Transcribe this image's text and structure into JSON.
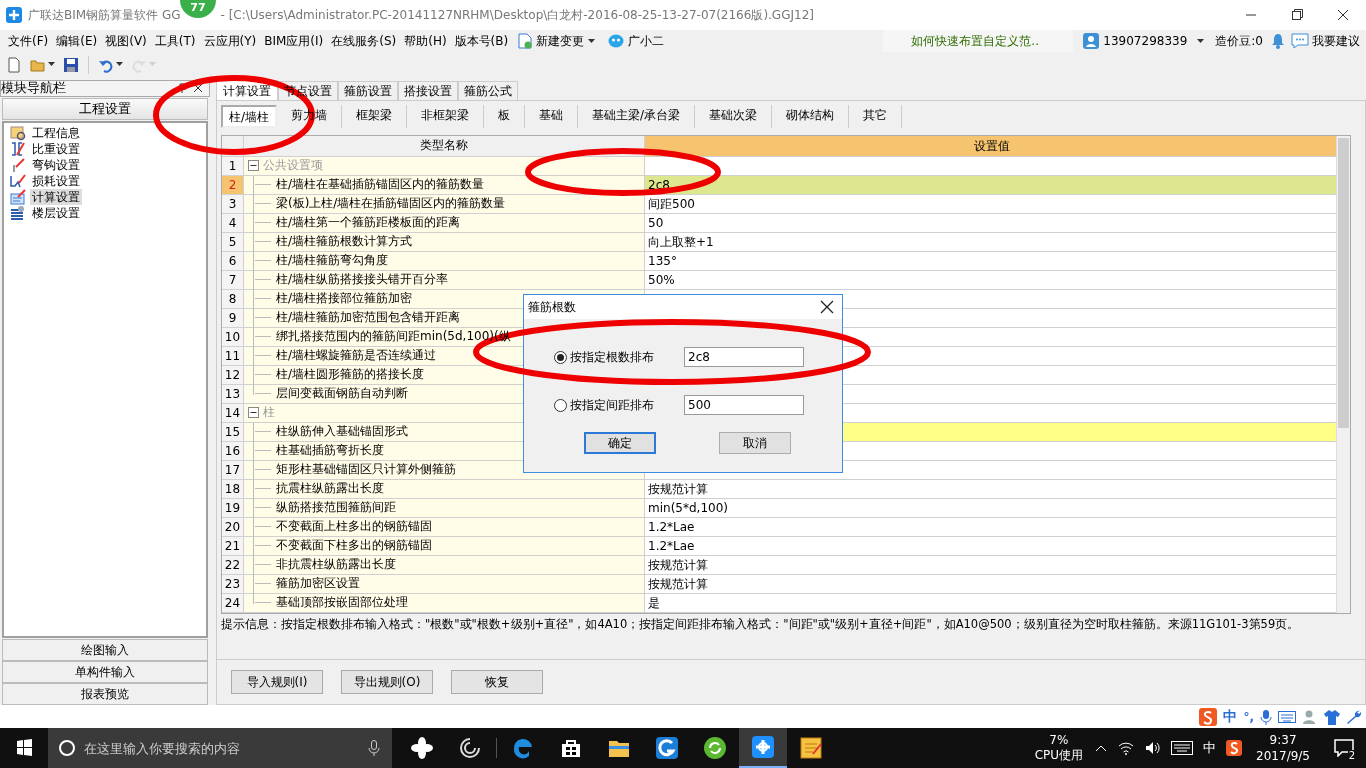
{
  "window": {
    "title_start": "广联达BIM钢筋算量软件 GG",
    "title_rest": "- [C:\\Users\\Administrator.PC-20141127NRHM\\Desktop\\白龙村-2016-08-25-13-27-07(2166版).GGJ12]",
    "badge": "77"
  },
  "menu": [
    "文件(F)",
    "编辑(E)",
    "视图(V)",
    "工具(T)",
    "云应用(Y)",
    "BIM应用(I)",
    "在线服务(S)",
    "帮助(H)",
    "版本号(B)"
  ],
  "menu_extras": [
    {
      "kind": "change",
      "label": "新建变更"
    },
    {
      "kind": "assistant",
      "label": "广小二"
    }
  ],
  "tip_link": "如何快速布置自定义范..",
  "account": {
    "user": "13907298339",
    "beans": "造价豆:0",
    "suggest": "我要建议"
  },
  "toolbar": [
    {
      "kind": "new",
      "disabled": false
    },
    {
      "kind": "open",
      "disabled": false
    },
    {
      "kind": "save",
      "disabled": false
    },
    {
      "kind": "undo",
      "disabled": false
    },
    {
      "kind": "redo",
      "disabled": true
    }
  ],
  "nav": {
    "title": "模块导航栏",
    "section": "工程设置",
    "items": [
      {
        "kind": "info",
        "label": "工程信息",
        "selected": false
      },
      {
        "kind": "weight",
        "label": "比重设置",
        "selected": false
      },
      {
        "kind": "hook",
        "label": "弯钩设置",
        "selected": false
      },
      {
        "kind": "loss",
        "label": "损耗设置",
        "selected": false
      },
      {
        "kind": "calc",
        "label": "计算设置",
        "selected": true
      },
      {
        "kind": "floor",
        "label": "楼层设置",
        "selected": false
      }
    ],
    "bottom": [
      "绘图输入",
      "单构件输入",
      "报表预览"
    ]
  },
  "tabs": [
    {
      "label": "计算设置",
      "selected": true
    },
    {
      "label": "节点设置",
      "selected": false
    },
    {
      "label": "箍筋设置",
      "selected": false
    },
    {
      "label": "搭接设置",
      "selected": false
    },
    {
      "label": "箍筋公式",
      "selected": false
    }
  ],
  "subtabs": [
    {
      "label": "柱/墙柱",
      "selected": true
    },
    {
      "label": "剪力墙",
      "selected": false
    },
    {
      "label": "框架梁",
      "selected": false
    },
    {
      "label": "非框架梁",
      "selected": false
    },
    {
      "label": "板",
      "selected": false
    },
    {
      "label": "基础",
      "selected": false
    },
    {
      "label": "基础主梁/承台梁",
      "selected": false
    },
    {
      "label": "基础次梁",
      "selected": false
    },
    {
      "label": "砌体结构",
      "selected": false
    },
    {
      "label": "其它",
      "selected": false
    }
  ],
  "grid": {
    "columns": [
      "类型名称",
      "设置值"
    ],
    "groups": [
      {
        "number": "1",
        "label": "公共设置项",
        "expanded": true,
        "children": [
          {
            "number": "2",
            "name": "柱/墙柱在基础插筋锚固区内的箍筋数量",
            "value": "2c8",
            "selected": true,
            "highlighted": false
          },
          {
            "number": "3",
            "name": "梁(板)上柱/墙柱在插筋锚固区内的箍筋数量",
            "value": "间距500",
            "selected": false,
            "highlighted": false
          },
          {
            "number": "4",
            "name": "柱/墙柱第一个箍筋距楼板面的距离",
            "value": "50",
            "selected": false,
            "highlighted": false
          },
          {
            "number": "5",
            "name": "柱/墙柱箍筋根数计算方式",
            "value": "向上取整+1",
            "selected": false,
            "highlighted": false
          },
          {
            "number": "6",
            "name": "柱/墙柱箍筋弯勾角度",
            "value": "135°",
            "selected": false,
            "highlighted": false
          },
          {
            "number": "7",
            "name": "柱/墙柱纵筋搭接接头错开百分率",
            "value": "50%",
            "selected": false,
            "highlighted": false
          },
          {
            "number": "8",
            "name": "柱/墙柱搭接部位箍筋加密",
            "selected": false,
            "highlighted": false
          },
          {
            "number": "9",
            "name": "柱/墙柱箍筋加密范围包含错开距离",
            "selected": false,
            "highlighted": false
          },
          {
            "number": "10",
            "name": "绑扎搭接范围内的箍筋间距min(5d,100)(纵",
            "selected": false,
            "highlighted": false
          },
          {
            "number": "11",
            "name": "柱/墙柱螺旋箍筋是否连续通过",
            "selected": false,
            "highlighted": false
          },
          {
            "number": "12",
            "name": "柱/墙柱圆形箍筋的搭接长度",
            "selected": false,
            "highlighted": false
          },
          {
            "number": "13",
            "name": "层间变截面钢筋自动判断",
            "selected": false,
            "highlighted": false
          }
        ]
      },
      {
        "number": "14",
        "label": "柱",
        "expanded": true,
        "children": [
          {
            "number": "15",
            "name": "柱纵筋伸入基础锚固形式",
            "selected": false,
            "highlighted": true
          },
          {
            "number": "16",
            "name": "柱基础插筋弯折长度",
            "selected": false,
            "highlighted": false
          },
          {
            "number": "17",
            "name": "矩形柱基础锚固区只计算外侧箍筋",
            "selected": false,
            "highlighted": false
          },
          {
            "number": "18",
            "name": "抗震柱纵筋露出长度",
            "value": "按规范计算",
            "selected": false,
            "highlighted": false
          },
          {
            "number": "19",
            "name": "纵筋搭接范围箍筋间距",
            "value": "min(5*d,100)",
            "selected": false,
            "highlighted": false
          },
          {
            "number": "20",
            "name": "不变截面上柱多出的钢筋锚固",
            "value": "1.2*Lae",
            "selected": false,
            "highlighted": false
          },
          {
            "number": "21",
            "name": "不变截面下柱多出的钢筋锚固",
            "value": "1.2*Lae",
            "selected": false,
            "highlighted": false
          },
          {
            "number": "22",
            "name": "非抗震柱纵筋露出长度",
            "value": "按规范计算",
            "selected": false,
            "highlighted": false
          },
          {
            "number": "23",
            "name": "箍筋加密区设置",
            "value": "按规范计算",
            "selected": false,
            "highlighted": false
          },
          {
            "number": "24",
            "name": "基础顶部按嵌固部位处理",
            "value": "是",
            "selected": false,
            "highlighted": false
          }
        ]
      }
    ]
  },
  "hint": "提示信息：按指定根数排布输入格式：\"根数\"或\"根数+级别+直径\"，如4A10；按指定间距排布输入格式：\"间距\"或\"级别+直径+间距\"，如A10@500；级别直径为空时取柱箍筋。来源11G101-3第59页。",
  "buttons": [
    "导入规则(I)",
    "导出规则(O)",
    "恢复"
  ],
  "dialog": {
    "title": "箍筋根数",
    "options": [
      {
        "label": "按指定根数排布",
        "value": "2c8",
        "selected": true
      },
      {
        "label": "按指定间距排布",
        "value": "500",
        "selected": false
      }
    ],
    "buttons": [
      {
        "label": "确定",
        "default": true
      },
      {
        "label": "取消",
        "default": false
      }
    ]
  },
  "annotations": [
    {
      "kind": "ellipse"
    },
    {
      "kind": "ellipse"
    },
    {
      "kind": "ellipse"
    }
  ],
  "ime": {
    "mode": "中",
    "punct": "°,"
  },
  "taskbar": {
    "search_placeholder": "在这里输入你要搜索的内容",
    "apps": [
      {
        "kind": "pinwheel",
        "active": false
      },
      {
        "kind": "swirl",
        "active": false
      },
      {
        "kind": "edge",
        "active": false
      },
      {
        "kind": "store",
        "active": false
      },
      {
        "kind": "folder",
        "active": false
      },
      {
        "kind": "glodon",
        "active": false
      },
      {
        "kind": "refresh",
        "active": false
      },
      {
        "kind": "cross",
        "active": true
      },
      {
        "kind": "notes",
        "active": false
      }
    ],
    "cpu": "7%",
    "cpu_label": "CPU使用",
    "lang": "中",
    "time": "9:37",
    "date": "2017/9/5",
    "notifications": "2"
  }
}
